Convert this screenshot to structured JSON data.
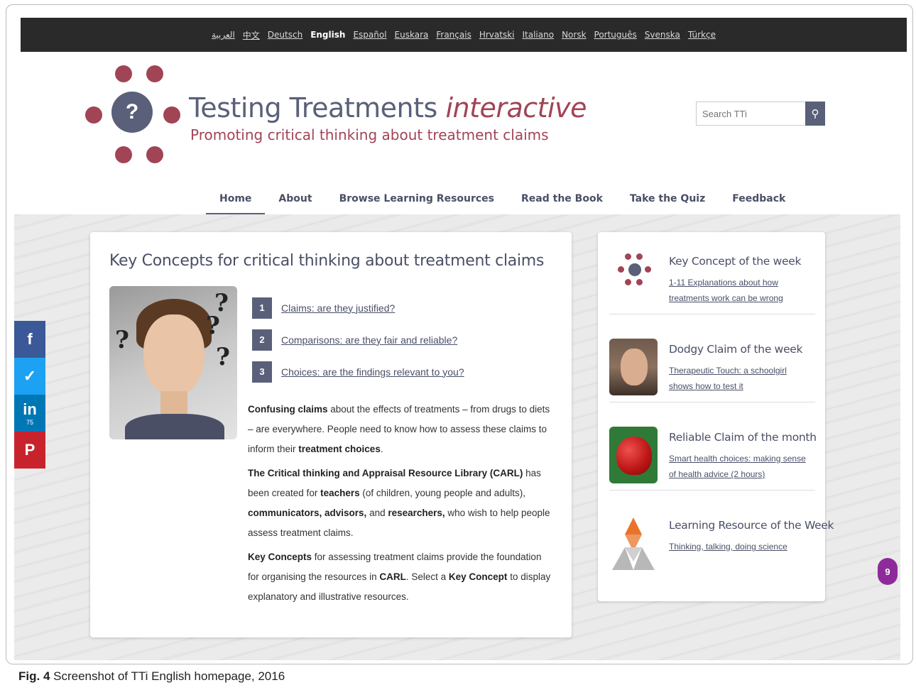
{
  "languages": [
    "العربية",
    "中文",
    "Deutsch",
    "English",
    "Español",
    "Euskara",
    "Français",
    "Hrvatski",
    "Italiano",
    "Norsk",
    "Português",
    "Svenska",
    "Türkçe"
  ],
  "brand": {
    "title_main": "Testing Treatments",
    "title_accent": "interactive",
    "tagline": "Promoting critical thinking about treatment claims"
  },
  "search": {
    "placeholder": "Search TTi"
  },
  "nav": [
    "Home",
    "About",
    "Browse Learning Resources",
    "Read the Book",
    "Take the Quiz",
    "Feedback"
  ],
  "share": {
    "linkedin_count": "75"
  },
  "main": {
    "heading": "Key Concepts for critical thinking about treatment claims",
    "concepts": [
      {
        "num": "1",
        "label": "Claims: are they justified?"
      },
      {
        "num": "2",
        "label": "Comparisons: are they fair and reliable?"
      },
      {
        "num": "3",
        "label": "Choices: are the findings relevant to you?"
      }
    ],
    "p1": {
      "b1": "Confusing claims",
      "t1": " about the effects of treatments – from drugs to diets – are everywhere. People need to know how to assess these claims to inform their ",
      "b2": "treatment choices",
      "t2": "."
    },
    "p2": {
      "b1": "The Critical thinking and Appraisal Resource Library (CARL)",
      "t1": " has been created for ",
      "b2": "teachers",
      "t2": " (of children, young people and adults), ",
      "b3": "communicators, advisors,",
      "t3": " and ",
      "b4": "researchers,",
      "t4": " who wish to help people assess treatment claims."
    },
    "p3": {
      "b1": "Key Concepts",
      "t1": " for assessing treatment claims provide the foundation for organising the resources in ",
      "b2": "CARL",
      "t2": ". Select a ",
      "b3": "Key Concept",
      "t3": " to display explanatory and illustrative resources."
    }
  },
  "side": [
    {
      "title": "Key Concept of the week",
      "link": "1-11 Explanations about how treatments work can be wrong"
    },
    {
      "title": "Dodgy Claim of the week",
      "link": "Therapeutic Touch: a schoolgirl shows how to test it"
    },
    {
      "title": "Reliable Claim of the month",
      "link": "Smart health choices: making sense of health advice (2 hours)"
    },
    {
      "title": "Learning Resource of the Week",
      "link": "Thinking, talking, doing science"
    }
  ],
  "badge_count": "9",
  "caption": {
    "label": "Fig. 4",
    "text": " Screenshot of TTi English homepage, 2016"
  }
}
